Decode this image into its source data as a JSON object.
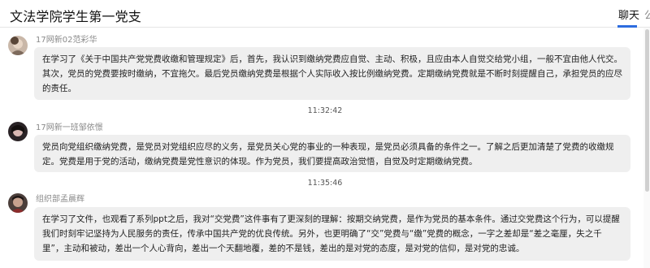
{
  "header": {
    "title": "文法学院学生第一党支",
    "tab_chat": "聊天",
    "tab_more": "公"
  },
  "messages": [
    {
      "sender": "17网新02范彩华",
      "text": "在学习了《关于中国共产党党费收缴和管理规定》后，首先，我认识到缴纳党费应自觉、主动、积极，且应由本人自觉交给党小组，一般不宜由他人代交。其次，党员的党费要按时缴纳，不宜拖欠。最后党员缴纳党费是根据个人实际收入按比例缴纳党费。定期缴纳党费就是不断时刻提醒自己，承担党员的应尽的责任。",
      "time": "11:32:42"
    },
    {
      "sender": "17网新一班邹依憬",
      "text": "党员向党组织缴纳党费，是党员对党组织应尽的义务，是党员关心党的事业的一种表现，是党员必须具备的条件之一。了解之后更加清楚了党费的收缴规定。党费是用于党的活动，缴纳党费是党性意识的体现。作为党员，我们要提高政治觉悟，自觉及时定期缴纳党费。",
      "time": "11:35:46"
    },
    {
      "sender": "组织部孟晨辉",
      "text": "在学习了文件，也观看了系列ppt之后，我对“交党费”这件事有了更深刻的理解：按期交纳党费，是作为党员的基本条件。通过交党费这个行为，可以提醒我们时刻牢记坚持为人民服务的责任，传承中国共产党的优良传统。另外，也更明确了“交”党费与“缴”党费的概念，一字之差却是“差之毫厘，失之千里”，主动和被动，差出一个人心背向，差出一个天翻地覆，差的不是钱，差出的是对党的态度，是对党的信仰，是对党的忠诚。"
    }
  ]
}
